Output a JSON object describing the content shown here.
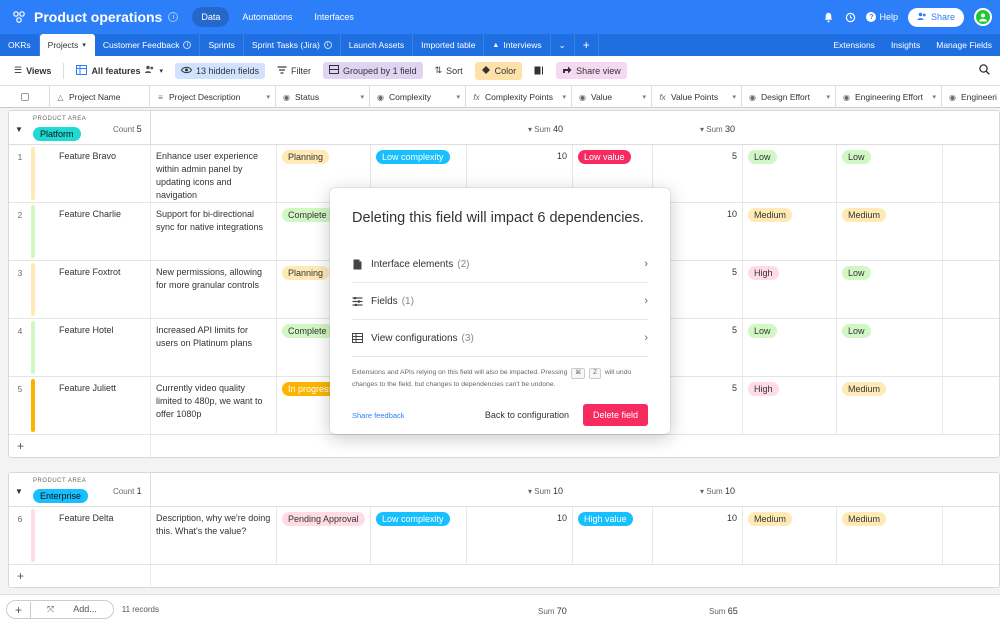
{
  "topbar": {
    "title": "Product operations",
    "nav": [
      "Data",
      "Automations",
      "Interfaces"
    ],
    "help": "Help",
    "share": "Share"
  },
  "tabs": {
    "items": [
      "OKRs",
      "Projects",
      "Customer Feedback",
      "Sprints",
      "Sprint Tasks (Jira)",
      "Launch Assets",
      "Imported table",
      "Interviews"
    ],
    "right": [
      "Extensions",
      "Insights",
      "Manage Fields"
    ]
  },
  "toolbar": {
    "views": "Views",
    "view_name": "All features",
    "hidden": "13 hidden fields",
    "filter": "Filter",
    "group": "Grouped by 1 field",
    "sort": "Sort",
    "color": "Color",
    "share": "Share view"
  },
  "columns": [
    "Project Name",
    "Project Description",
    "Status",
    "Complexity",
    "Complexity Points",
    "Value",
    "Value Points",
    "Design Effort",
    "Engineering Effort",
    "Engineeri"
  ],
  "groups": [
    {
      "label": "PRODUCT AREA",
      "name": "Platform",
      "pill_color": "#20d9d2",
      "count_label": "Count",
      "count": "5",
      "sum_label": "Sum",
      "complexity_sum": "40",
      "value_sum": "30",
      "rows": [
        {
          "num": "1",
          "bar": "#ffeab6",
          "name": "Feature Bravo",
          "desc": "Enhance user experience within admin panel by updating icons and navigation",
          "status": "Planning",
          "status_color": "#ffeab6",
          "complexity": "Low complexity",
          "complexity_color": "#18bfff",
          "cpoints": "10",
          "value": "Low value",
          "value_color": "#f82b60",
          "vpoints": "5",
          "design": "Low",
          "design_color": "#d1f7c4",
          "eng": "Low",
          "eng_color": "#d1f7c4"
        },
        {
          "num": "2",
          "bar": "#d1f7c4",
          "name": "Feature Charlie",
          "desc": "Support for bi-directional sync for native integrations",
          "status": "Complete",
          "status_color": "#d1f7c4",
          "complexity": "",
          "complexity_color": "",
          "cpoints": "",
          "value": "",
          "value_color": "",
          "vpoints": "10",
          "design": "Medium",
          "design_color": "#ffeab6",
          "eng": "Medium",
          "eng_color": "#ffeab6"
        },
        {
          "num": "3",
          "bar": "#ffeab6",
          "name": "Feature Foxtrot",
          "desc": "New permissions, allowing for more granular controls",
          "status": "Planning",
          "status_color": "#ffeab6",
          "complexity": "",
          "complexity_color": "",
          "cpoints": "",
          "value": "",
          "value_color": "",
          "vpoints": "5",
          "design": "High",
          "design_color": "#ffdce5",
          "eng": "Low",
          "eng_color": "#d1f7c4"
        },
        {
          "num": "4",
          "bar": "#d1f7c4",
          "name": "Feature Hotel",
          "desc": "Increased API limits for users on Platinum plans",
          "status": "Complete",
          "status_color": "#d1f7c4",
          "complexity": "",
          "complexity_color": "",
          "cpoints": "",
          "value": "",
          "value_color": "",
          "vpoints": "5",
          "design": "Low",
          "design_color": "#d1f7c4",
          "eng": "Low",
          "eng_color": "#d1f7c4"
        },
        {
          "num": "5",
          "bar": "#fcb400",
          "name": "Feature Juliett",
          "desc": "Currently video quality limited to 480p, we want to offer 1080p",
          "status": "In progress",
          "status_color": "#fcb400",
          "complexity": "",
          "complexity_color": "",
          "cpoints": "",
          "value": "",
          "value_color": "",
          "vpoints": "5",
          "design": "High",
          "design_color": "#ffdce5",
          "eng": "Medium",
          "eng_color": "#ffeab6"
        }
      ]
    },
    {
      "label": "PRODUCT AREA",
      "name": "Enterprise",
      "pill_color": "#18bfff",
      "count_label": "Count",
      "count": "1",
      "sum_label": "Sum",
      "complexity_sum": "10",
      "value_sum": "10",
      "rows": [
        {
          "num": "6",
          "bar": "#ffdce5",
          "name": "Feature Delta",
          "desc": "Description, why we're doing this. What's the value?",
          "status": "Pending Approval",
          "status_color": "#ffdce5",
          "complexity": "Low complexity",
          "complexity_color": "#18bfff",
          "cpoints": "10",
          "value": "High value",
          "value_color": "#18bfff",
          "vpoints": "10",
          "design": "Medium",
          "design_color": "#ffeab6",
          "eng": "Medium",
          "eng_color": "#ffeab6"
        }
      ]
    }
  ],
  "footer": {
    "add": "Add...",
    "records": "11 records",
    "sum_label": "Sum",
    "complexity_sum": "70",
    "value_sum": "65"
  },
  "modal": {
    "title": "Deleting this field will impact 6 dependencies.",
    "items": [
      {
        "label": "Interface elements",
        "count": "(2)",
        "icon": "document-icon"
      },
      {
        "label": "Fields",
        "count": "(1)",
        "icon": "fields-icon"
      },
      {
        "label": "View configurations",
        "count": "(3)",
        "icon": "table-icon"
      }
    ],
    "note_before": "Extensions and APIs relying on this field will also be impacted. Pressing",
    "key1": "⌘",
    "key2": "Z",
    "note_after": "will undo changes to the field, but changes to dependencies can't be undone.",
    "feedback": "Share feedback",
    "back": "Back to configuration",
    "delete": "Delete field"
  },
  "colors": {
    "brand": "#2d7ff9",
    "tabs_bg": "#1f6fe0",
    "danger": "#f82b60"
  }
}
